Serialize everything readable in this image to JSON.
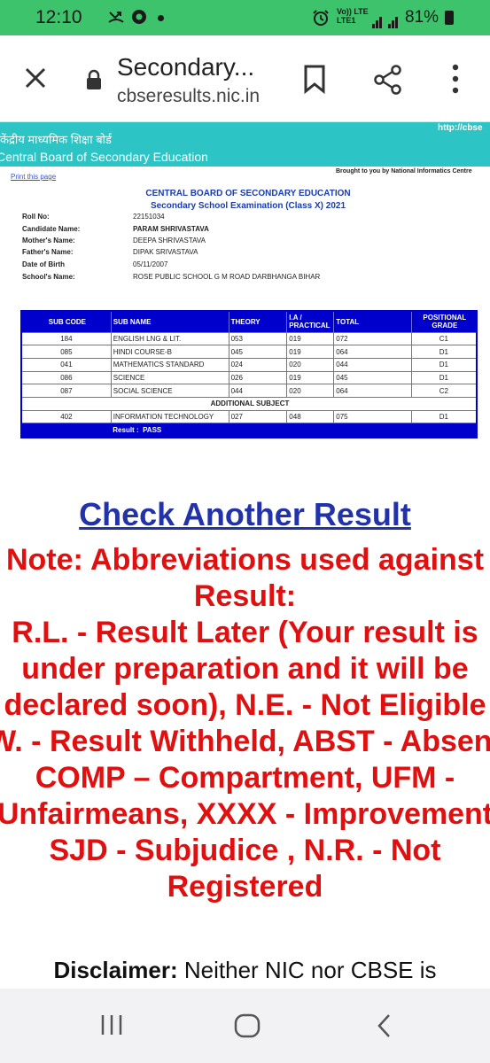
{
  "status_bar": {
    "time": "12:10",
    "network": "Vo)) LTE\nLTE1",
    "battery": "81%"
  },
  "browser": {
    "page_title": "Secondary...",
    "url": "cbseresults.nic.in"
  },
  "site_header": {
    "hindi_title": "केंद्रीय माध्यमिक शिक्षा बोर्ड",
    "english_title": "Central Board of Secondary Education",
    "site_link": "http://cbse"
  },
  "page": {
    "print_link": "Print this page",
    "brought_by": "Brought to you by National Informatics Centre",
    "board_name": "CENTRAL BOARD OF SECONDARY EDUCATION",
    "exam_name": "Secondary School Examination (Class X) 2021"
  },
  "candidate": [
    {
      "label": "Roll No:",
      "value": "22151034"
    },
    {
      "label": "Candidate Name:",
      "value": "PARAM SHRIVASTAVA"
    },
    {
      "label": "Mother's Name:",
      "value": "DEEPA SHRIVASTAVA"
    },
    {
      "label": "Father's Name:",
      "value": "DIPAK SRIVASTAVA"
    },
    {
      "label": "Date of Birth",
      "value": "05/11/2007"
    },
    {
      "label": "School's Name:",
      "value": "ROSE PUBLIC SCHOOL G M ROAD DARBHANGA BIHAR"
    }
  ],
  "marks_table": {
    "headers": [
      "SUB CODE",
      "SUB NAME",
      "THEORY",
      "I.A / PRACTICAL",
      "TOTAL",
      "POSITIONAL GRADE"
    ],
    "rows": [
      [
        "184",
        "ENGLISH LNG & LIT.",
        "053",
        "019",
        "072",
        "C1"
      ],
      [
        "085",
        "HINDI COURSE-B",
        "045",
        "019",
        "064",
        "D1"
      ],
      [
        "041",
        "MATHEMATICS STANDARD",
        "024",
        "020",
        "044",
        "D1"
      ],
      [
        "086",
        "SCIENCE",
        "026",
        "019",
        "045",
        "D1"
      ],
      [
        "087",
        "SOCIAL SCIENCE",
        "044",
        "020",
        "064",
        "C2"
      ]
    ],
    "additional_label": "ADDITIONAL SUBJECT",
    "additional_rows": [
      [
        "402",
        "INFORMATION TECHNOLOGY",
        "027",
        "048",
        "075",
        "D1"
      ]
    ],
    "result_label": "Result :",
    "result_value": "PASS"
  },
  "check_another": "Check Another Result",
  "note_lines": [
    "Note: Abbreviations used against",
    "Result:",
    "R.L. - Result Later (Your result is",
    "under preparation and it will be",
    "declared soon), N.E. - Not Eligible",
    "W. - Result Withheld, ABST - Absent",
    "COMP – Compartment, UFM -",
    "Unfairmeans, XXXX - Improvement",
    "SJD - Subjudice , N.R. - Not",
    "Registered"
  ],
  "disclaimer": {
    "label": "Disclaimer:",
    "text": " Neither NIC nor CBSE is"
  }
}
